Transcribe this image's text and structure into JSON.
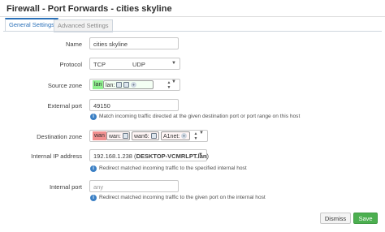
{
  "dialog": {
    "title": "Firewall - Port Forwards - cities skyline"
  },
  "tabs": [
    {
      "label": "General Settings",
      "active": true
    },
    {
      "label": "Advanced Settings",
      "active": false
    }
  ],
  "fields": {
    "name": {
      "label": "Name",
      "value": "cities skyline"
    },
    "protocol": {
      "label": "Protocol",
      "values": [
        "TCP",
        "UDP"
      ]
    },
    "source_zone": {
      "label": "Source zone",
      "zone_badge": "lan",
      "zone_name": "lan:",
      "zone_color": "#90f090",
      "icons": [
        "network-icon",
        "network-icon",
        "wifi-icon"
      ]
    },
    "external_port": {
      "label": "External port",
      "value": "49150",
      "help": "Match incoming traffic directed at the given destination port or port range on this host"
    },
    "destination_zone": {
      "label": "Destination zone",
      "zone_color": "#f09090",
      "zone_badge": "wan",
      "chips": [
        {
          "label": "wan:",
          "icons": [
            "network-icon"
          ]
        },
        {
          "label": "wan6:",
          "icons": [
            "network-icon"
          ]
        },
        {
          "label": "A1net:",
          "icons": [
            "wifi-icon"
          ]
        }
      ]
    },
    "internal_ip": {
      "label": "Internal IP address",
      "value": "192.168.1.238",
      "host": "DESKTOP-VCMRLPT.lan",
      "help": "Redirect matched incoming traffic to the specified internal host"
    },
    "internal_port": {
      "label": "Internal port",
      "placeholder": "any",
      "help": "Redirect matched incoming traffic to the given port on the internal host"
    }
  },
  "buttons": {
    "dismiss": "Dismiss",
    "save": "Save"
  },
  "colors": {
    "accent": "#2a70b8",
    "save": "#4caf50",
    "help_icon": "#3a7fc4"
  }
}
